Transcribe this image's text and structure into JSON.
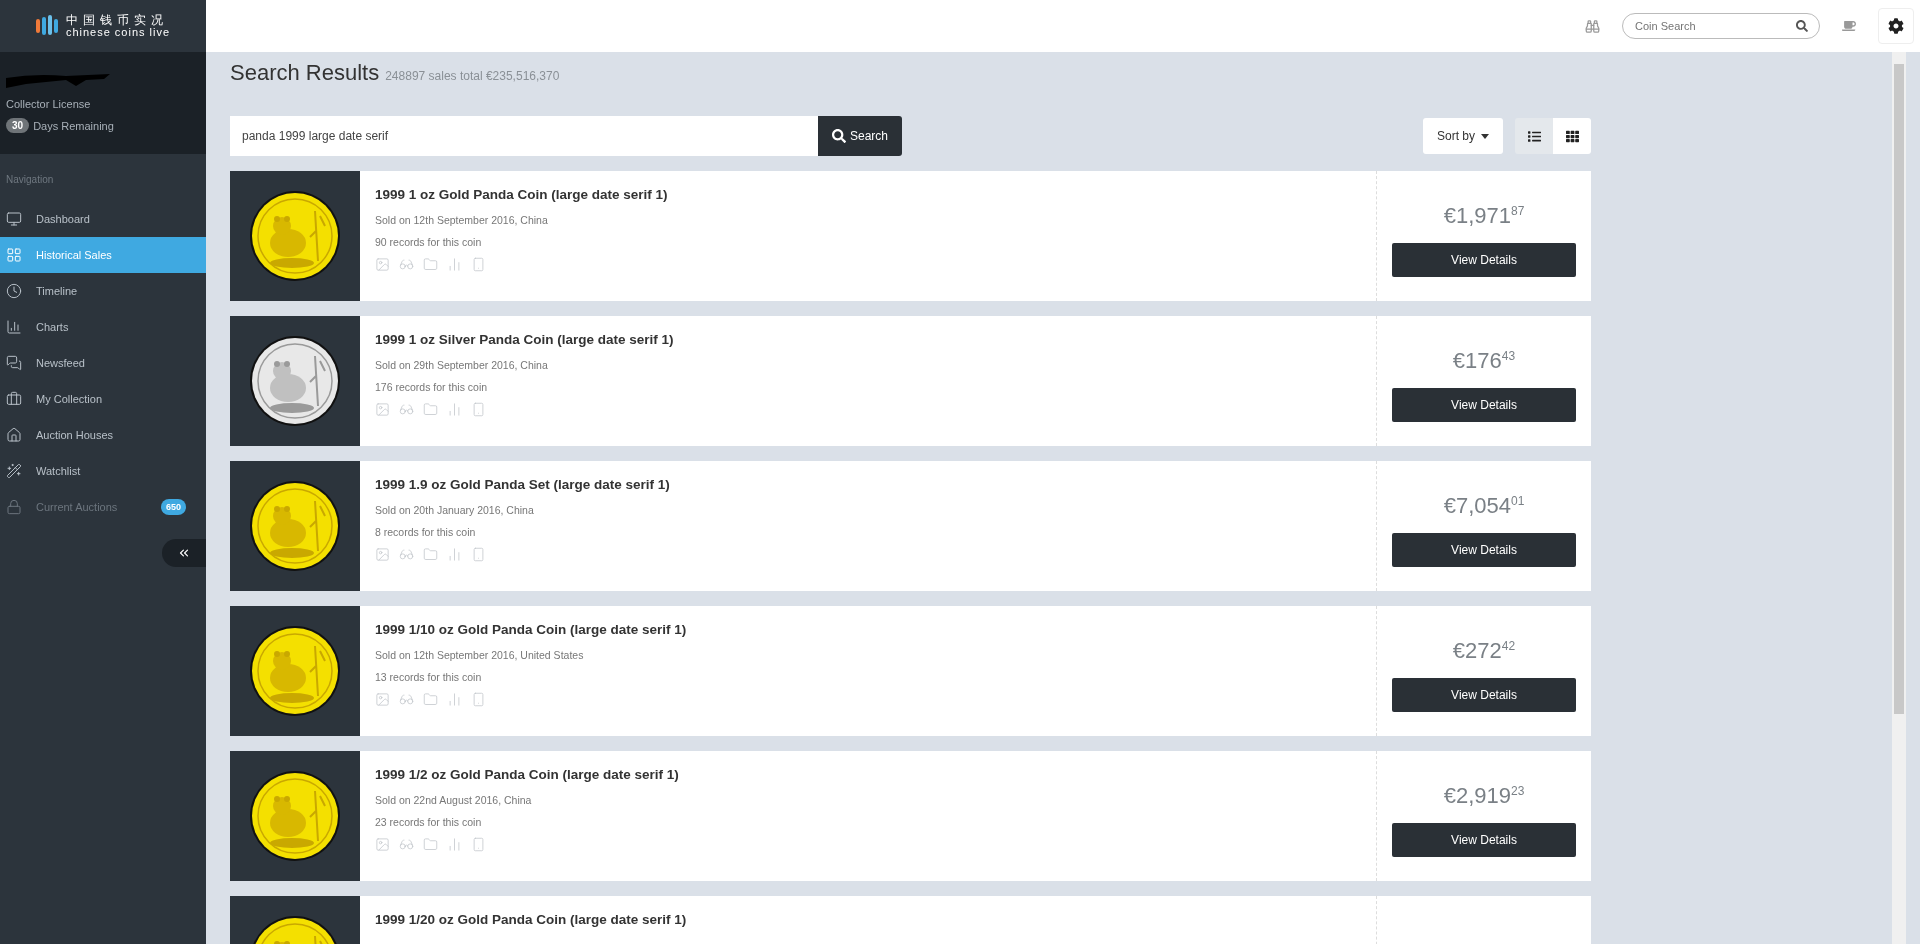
{
  "logo": {
    "chinese": "中国钱币实况",
    "english": "chinese coins live"
  },
  "account": {
    "license": "Collector License",
    "days": "30",
    "days_label": "Days Remaining"
  },
  "sidebar": {
    "heading": "Navigation",
    "items": [
      {
        "label": "Dashboard",
        "selected": false,
        "disabled": false
      },
      {
        "label": "Historical Sales",
        "selected": true,
        "disabled": false
      },
      {
        "label": "Timeline",
        "selected": false,
        "disabled": false
      },
      {
        "label": "Charts",
        "selected": false,
        "disabled": false
      },
      {
        "label": "Newsfeed",
        "selected": false,
        "disabled": false
      },
      {
        "label": "My Collection",
        "selected": false,
        "disabled": false
      },
      {
        "label": "Auction Houses",
        "selected": false,
        "disabled": false
      },
      {
        "label": "Watchlist",
        "selected": false,
        "disabled": false
      },
      {
        "label": "Current Auctions",
        "selected": false,
        "disabled": true,
        "badge": "650"
      }
    ]
  },
  "topbar": {
    "search_placeholder": "Coin Search"
  },
  "page": {
    "title": "Search Results",
    "summary": "248897 sales total €235,516,370",
    "query": "panda 1999 large date serif",
    "search_button": "Search",
    "sort_button": "Sort by",
    "views": [
      {
        "kind": "list",
        "selected": true
      },
      {
        "kind": "grid",
        "selected": false
      }
    ]
  },
  "results": [
    {
      "title": "1999 1 oz Gold Panda Coin (large date serif 1)",
      "sold": "Sold on 12th September 2016, China",
      "records": "90 records for this coin",
      "price": "€1,971",
      "cents": "87",
      "button": "View Details",
      "kind": "gold"
    },
    {
      "title": "1999 1 oz Silver Panda Coin (large date serif 1)",
      "sold": "Sold on 29th September 2016, China",
      "records": "176 records for this coin",
      "price": "€176",
      "cents": "43",
      "button": "View Details",
      "kind": "silver"
    },
    {
      "title": "1999 1.9 oz Gold Panda Set (large date serif 1)",
      "sold": "Sold on 20th January 2016, China",
      "records": "8 records for this coin",
      "price": "€7,054",
      "cents": "01",
      "button": "View Details",
      "kind": "gold"
    },
    {
      "title": "1999 1/10 oz Gold Panda Coin (large date serif 1)",
      "sold": "Sold on 12th September 2016, United States",
      "records": "13 records for this coin",
      "price": "€272",
      "cents": "42",
      "button": "View Details",
      "kind": "gold"
    },
    {
      "title": "1999 1/2 oz Gold Panda Coin (large date serif 1)",
      "sold": "Sold on 22nd August 2016, China",
      "records": "23 records for this coin",
      "price": "€2,919",
      "cents": "23",
      "button": "View Details",
      "kind": "gold"
    },
    {
      "title": "1999 1/20 oz Gold Panda Coin (large date serif 1)",
      "kind": "gold"
    }
  ]
}
